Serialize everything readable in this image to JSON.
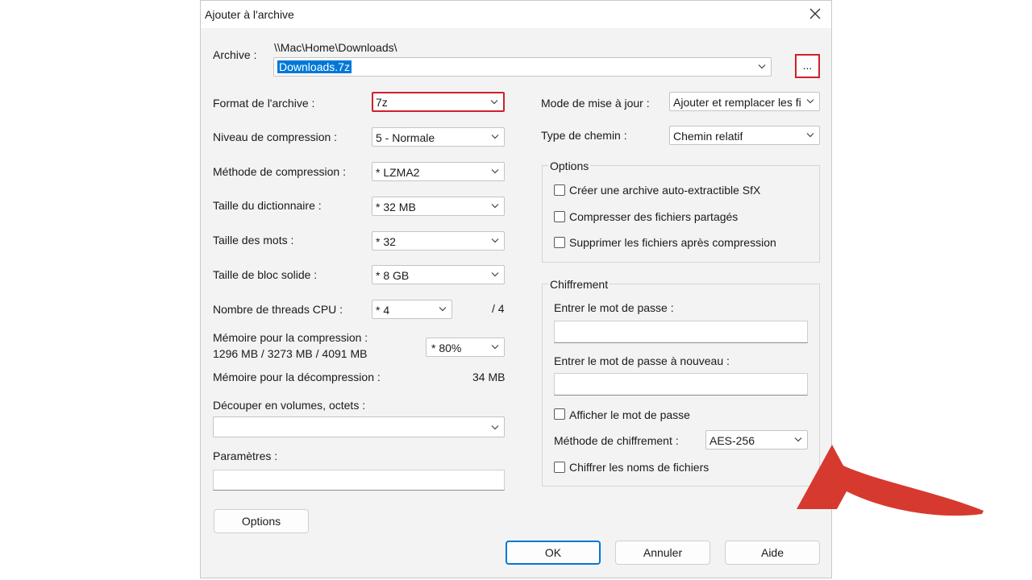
{
  "dialog": {
    "title": "Ajouter à l'archive"
  },
  "archive": {
    "label": "Archive :",
    "path": "\\\\Mac\\Home\\Downloads\\",
    "filename": "Downloads.7z",
    "browse_label": "..."
  },
  "left": {
    "format": {
      "label": "Format de l'archive :",
      "value": "7z"
    },
    "level": {
      "label": "Niveau de compression :",
      "value": "5 - Normale"
    },
    "method": {
      "label": "Méthode de compression :",
      "value": "*  LZMA2"
    },
    "dict": {
      "label": "Taille du dictionnaire :",
      "value": "*  32 MB"
    },
    "words": {
      "label": "Taille des mots :",
      "value": "*  32"
    },
    "solid": {
      "label": "Taille de bloc solide :",
      "value": "*  8 GB"
    },
    "threads": {
      "label": "Nombre de threads CPU :",
      "value": "*  4",
      "max": "/ 4"
    },
    "mem_comp": {
      "label": "Mémoire pour la compression :",
      "detail": "1296 MB / 3273 MB / 4091 MB",
      "value": "*  80%"
    },
    "mem_decomp": {
      "label": "Mémoire pour la décompression :",
      "value": "34 MB"
    },
    "split": {
      "label": "Découper en volumes, octets :",
      "value": ""
    },
    "params": {
      "label": "Paramètres :",
      "value": ""
    },
    "options_button": "Options"
  },
  "right": {
    "update": {
      "label": "Mode de mise à jour :",
      "value": "Ajouter et remplacer les fich"
    },
    "path_type": {
      "label": "Type de chemin :",
      "value": "Chemin relatif"
    },
    "options": {
      "title": "Options",
      "items": [
        "Créer une archive auto-extractible SfX",
        "Compresser des fichiers partagés",
        "Supprimer les fichiers après compression"
      ]
    },
    "encryption": {
      "title": "Chiffrement",
      "pw_label": "Entrer le mot de passe :",
      "pw2_label": "Entrer le mot de passe à nouveau :",
      "show_pw": "Afficher le mot de passe",
      "method_label": "Méthode de chiffrement :",
      "method_value": "AES-256",
      "encrypt_names": "Chiffrer les noms de fichiers"
    }
  },
  "buttons": {
    "ok": "OK",
    "cancel": "Annuler",
    "help": "Aide"
  },
  "colors": {
    "highlight": "#0078d7",
    "annotation_red": "#d0202a",
    "arrow_red": "#d63a2f"
  }
}
